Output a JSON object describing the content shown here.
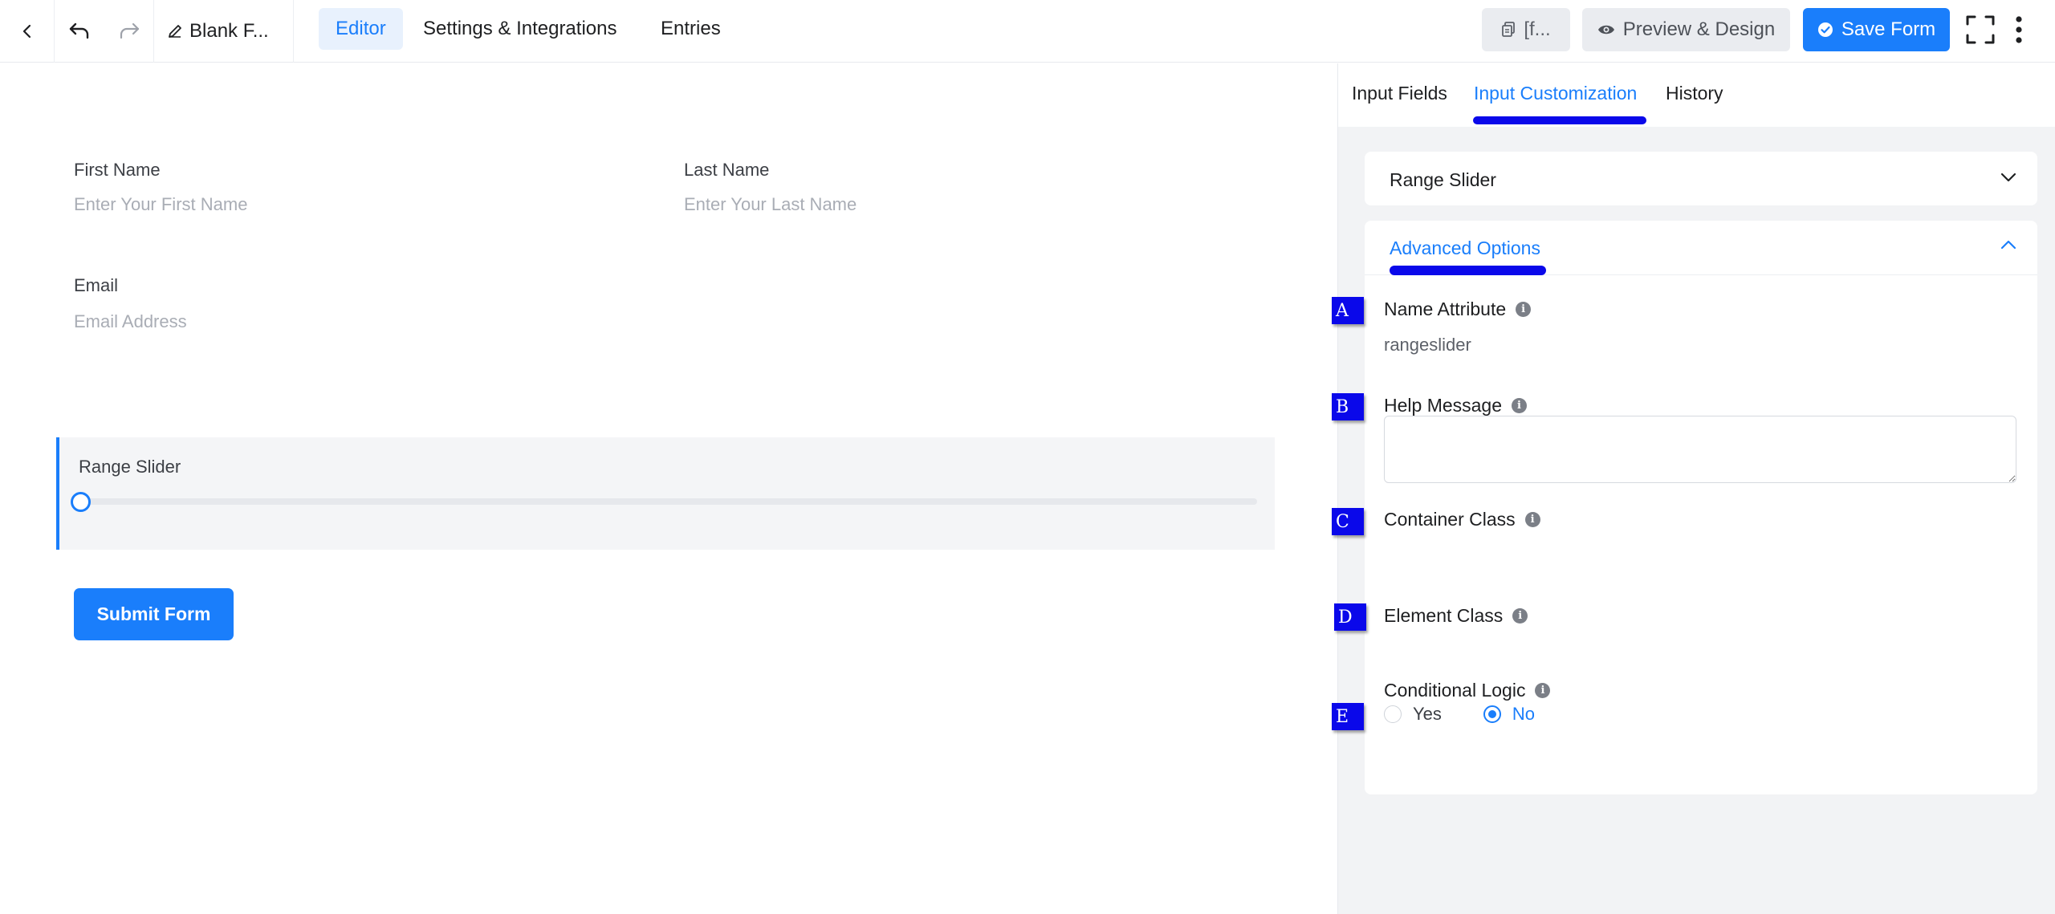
{
  "topbar": {
    "form_title": "Blank F...",
    "nav": [
      "Editor",
      "Settings & Integrations",
      "Entries"
    ],
    "shortcode_label": "[f...",
    "preview_label": "Preview & Design",
    "save_label": "Save Form"
  },
  "form": {
    "first_name": {
      "label": "First Name",
      "placeholder": "Enter Your First Name"
    },
    "last_name": {
      "label": "Last Name",
      "placeholder": "Enter Your Last Name"
    },
    "email": {
      "label": "Email",
      "placeholder": "Email Address"
    },
    "range": {
      "label": "Range Slider",
      "value_fraction": 0
    },
    "submit_label": "Submit Form"
  },
  "panel": {
    "tabs": [
      "Input Fields",
      "Input Customization",
      "History"
    ],
    "active_tab": "Input Customization",
    "field_card_title": "Range Slider",
    "advanced": {
      "title": "Advanced Options",
      "name_attribute": {
        "label": "Name Attribute",
        "value": "rangeslider"
      },
      "help_message": {
        "label": "Help Message",
        "value": ""
      },
      "container_class": {
        "label": "Container Class"
      },
      "element_class": {
        "label": "Element Class"
      },
      "conditional_logic": {
        "label": "Conditional Logic",
        "options": [
          "Yes",
          "No"
        ],
        "selected": "No"
      }
    }
  },
  "markers": [
    "A",
    "B",
    "C",
    "D",
    "E"
  ],
  "colors": {
    "accent": "#1a7efb",
    "marker": "#0a08ea"
  }
}
